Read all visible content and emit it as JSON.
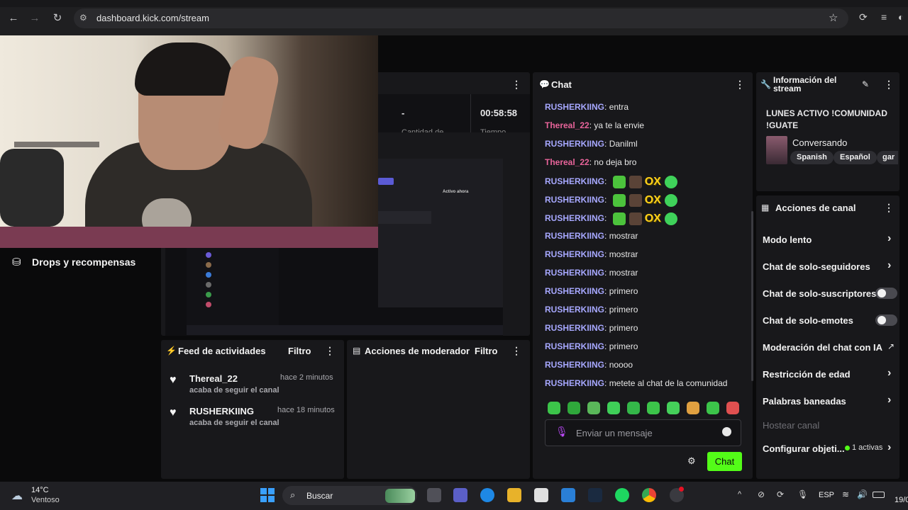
{
  "browser": {
    "url": "dashboard.kick.com/stream"
  },
  "left": {
    "drops_label": "Drops y recompensas"
  },
  "stats": {
    "dash": "-",
    "timer": "00:58:58",
    "cut_label_1": "Cantidad de",
    "cut_label_2": "Tiempo"
  },
  "feed": {
    "title": "Feed de actividades",
    "filter": "Filtro",
    "items": [
      {
        "name": "Thereal_22",
        "time": "hace 2 minutos",
        "action": "acaba de seguir el canal"
      },
      {
        "name": "RUSHERKIING",
        "time": "hace 18 minutos",
        "action": "acaba de seguir el canal"
      }
    ]
  },
  "mod": {
    "title": "Acciones de moderador",
    "filter": "Filtro"
  },
  "chat": {
    "title": "Chat",
    "messages": [
      {
        "user": "RUSHERKIING",
        "text": "entra",
        "type": "rush"
      },
      {
        "user": "Thereal_22",
        "text": "ya te la envie",
        "type": "the"
      },
      {
        "user": "RUSHERKIING",
        "text": "Danilml",
        "type": "rush"
      },
      {
        "user": "Thereal_22",
        "text": "no deja bro",
        "type": "the"
      },
      {
        "user": "RUSHERKIING",
        "text": "",
        "type": "rush",
        "emotes": true
      },
      {
        "user": "RUSHERKIING",
        "text": "",
        "type": "rush",
        "emotes": true
      },
      {
        "user": "RUSHERKIING",
        "text": "",
        "type": "rush",
        "emotes": true
      },
      {
        "user": "RUSHERKIING",
        "text": "mostrar",
        "type": "rush"
      },
      {
        "user": "RUSHERKIING",
        "text": "mostrar",
        "type": "rush"
      },
      {
        "user": "RUSHERKIING",
        "text": "mostrar",
        "type": "rush"
      },
      {
        "user": "RUSHERKIING",
        "text": "primero",
        "type": "rush"
      },
      {
        "user": "RUSHERKIING",
        "text": "primero",
        "type": "rush"
      },
      {
        "user": "RUSHERKIING",
        "text": "primero",
        "type": "rush"
      },
      {
        "user": "RUSHERKIING",
        "text": "primero",
        "type": "rush"
      },
      {
        "user": "RUSHERKIING",
        "text": "noooo",
        "type": "rush"
      },
      {
        "user": "RUSHERKIING",
        "text": "metete al chat de la comunidad",
        "type": "rush"
      }
    ],
    "emote_ox": "OX",
    "placeholder": "Enviar un mensaje",
    "send_label": "Chat"
  },
  "info": {
    "title_line1": "Información del",
    "title_line2": "stream",
    "stream_title_1": "LUNES ACTIVO !COMUNIDAD",
    "stream_title_2": "!GUATE",
    "category": "Conversando",
    "tags": [
      "Spanish",
      "Español",
      "gar"
    ]
  },
  "actions": {
    "title": "Acciones de canal",
    "items": [
      {
        "label": "Modo lento",
        "control": "chevron"
      },
      {
        "label": "Chat de solo-seguidores",
        "control": "chevron"
      },
      {
        "label": "Chat de solo-suscriptores",
        "control": "toggle"
      },
      {
        "label": "Chat de solo-emotes",
        "control": "toggle"
      },
      {
        "label": "Moderación del chat con IA",
        "control": "external"
      },
      {
        "label": "Restricción de edad",
        "control": "chevron"
      },
      {
        "label": "Palabras baneadas",
        "control": "chevron"
      }
    ],
    "host": "Hostear canal",
    "goals": "Configurar objeti...",
    "goals_badge": "1 activas"
  },
  "taskbar": {
    "temp": "14°C",
    "weather": "Ventoso",
    "search": "Buscar",
    "lang": "ESP",
    "date": "19/0"
  },
  "colors": {
    "accent": "#53fc18",
    "user_rush": "#a7a8ff",
    "user_the": "#e8649a"
  }
}
